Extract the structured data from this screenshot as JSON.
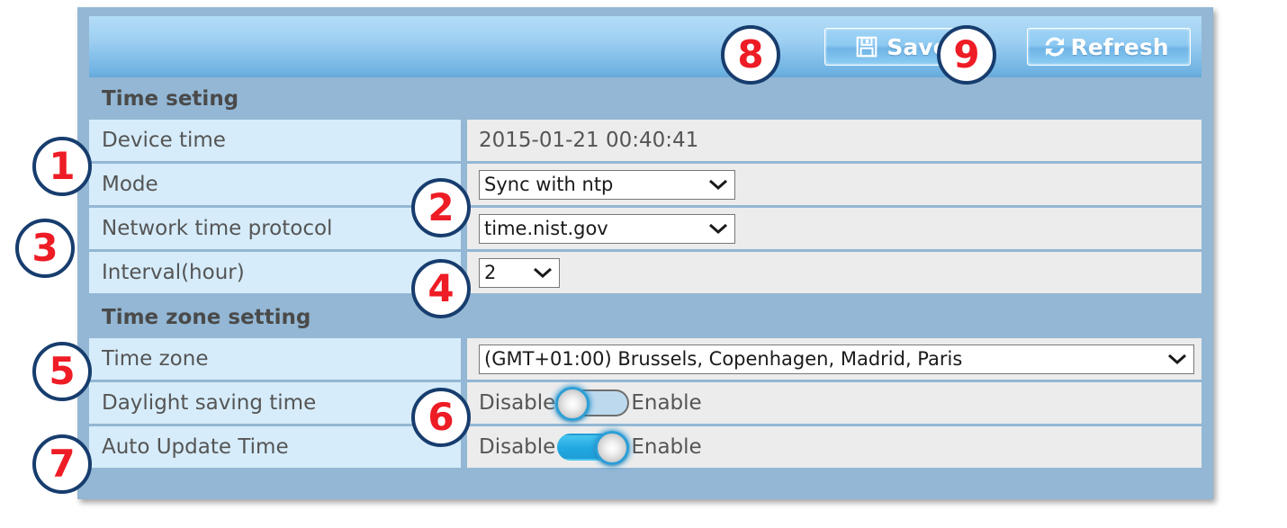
{
  "toolbar": {
    "save_label": "Save",
    "save_icon": "floppy-disk-icon",
    "refresh_label": "Refresh",
    "refresh_icon": "refresh-circular-arrows-icon"
  },
  "sections": {
    "time_setting_title": "Time seting",
    "time_zone_setting_title": "Time zone setting"
  },
  "rows": {
    "device_time": {
      "label": "Device time",
      "value": "2015-01-21 00:40:41"
    },
    "mode": {
      "label": "Mode",
      "value": "Sync with ntp"
    },
    "ntp": {
      "label": "Network time protocol",
      "value": "time.nist.gov"
    },
    "interval": {
      "label": "Interval(hour)",
      "value": "2"
    },
    "time_zone": {
      "label": "Time zone",
      "value": "(GMT+01:00) Brussels, Copenhagen, Madrid, Paris"
    },
    "dst": {
      "label": "Daylight saving time",
      "disable_label": "Disable",
      "enable_label": "Enable",
      "state": "off"
    },
    "auto_update": {
      "label": "Auto Update Time",
      "disable_label": "Disable",
      "enable_label": "Enable",
      "state": "on"
    }
  },
  "callouts": {
    "c1": "1",
    "c2": "2",
    "c3": "3",
    "c4": "4",
    "c5": "5",
    "c6": "6",
    "c7": "7",
    "c8": "8",
    "c9": "9"
  },
  "colors": {
    "panel_frame": "#93b7d4",
    "label_cell": "#d6ecfa",
    "value_cell": "#ececec",
    "header_blue": "#8ecaf2",
    "callout_border": "#173d6e",
    "callout_number": "#ee1c25",
    "toggle_on": "#21a8e0"
  }
}
